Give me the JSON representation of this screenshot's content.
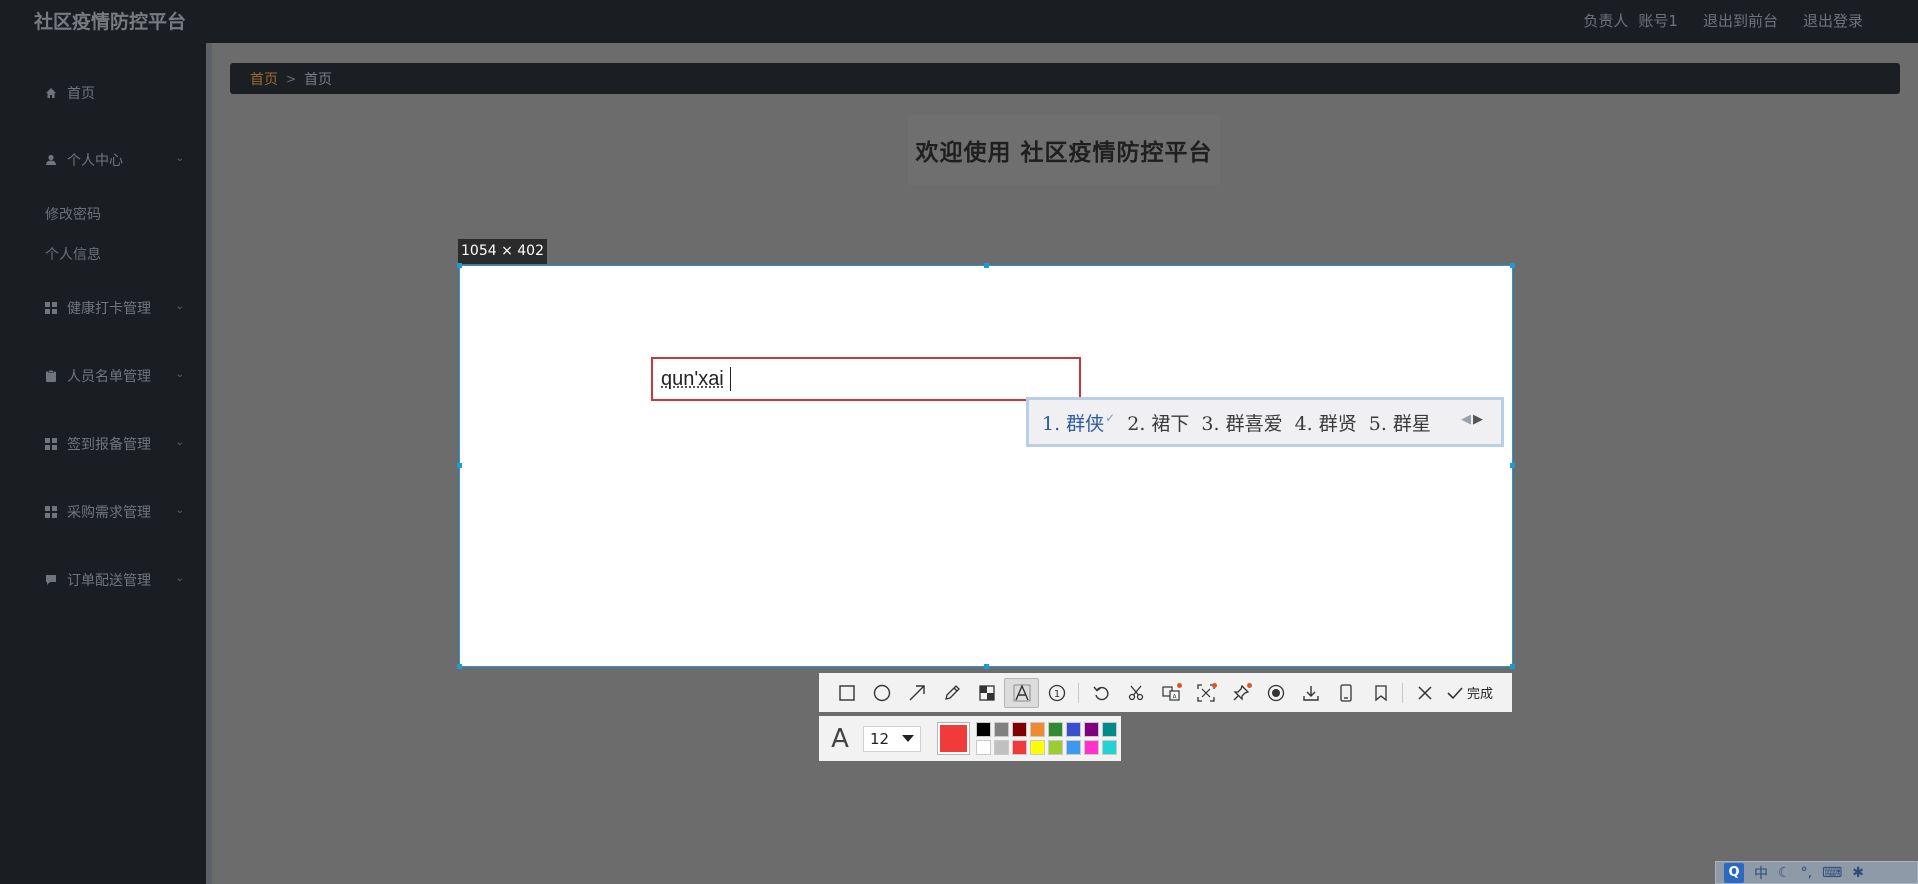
{
  "header": {
    "app_title": "社区疫情防控平台",
    "role": "负责人",
    "account": "账号1",
    "exit_front": "退出到前台",
    "logout": "退出登录"
  },
  "sidebar": {
    "home": "首页",
    "personal_center": "个人中心",
    "change_password": "修改密码",
    "personal_info": "个人信息",
    "health_checkin": "健康打卡管理",
    "personnel_list": "人员名单管理",
    "signin_report": "签到报备管理",
    "purchase_demand": "采购需求管理",
    "order_delivery": "订单配送管理"
  },
  "breadcrumb": {
    "home": "首页",
    "current": "首页"
  },
  "main": {
    "welcome": "欢迎使用 社区疫情防控平台"
  },
  "capture": {
    "size_label": "1054 × 402",
    "typed_text": "qun'xai",
    "ime_candidates": [
      "1. 群侠",
      "2. 裙下",
      "3. 群喜爱",
      "4. 群贤",
      "5. 群星"
    ]
  },
  "toolbar": {
    "icons": [
      "rectangle-icon",
      "ellipse-icon",
      "arrow-icon",
      "pencil-icon",
      "mosaic-icon",
      "text-icon",
      "number-icon",
      "undo-icon",
      "cut-icon",
      "translate-icon",
      "ocr-icon",
      "pin-icon",
      "record-icon",
      "download-icon",
      "phone-icon",
      "bookmark-icon",
      "close-icon"
    ],
    "done": "完成"
  },
  "text_options": {
    "font_size": "12",
    "current_color": "#f13a3a",
    "palette_top": [
      "#000000",
      "#808080",
      "#800000",
      "#f08a30",
      "#2e8b2e",
      "#3a4fd0",
      "#800080",
      "#008b8b"
    ],
    "palette_bottom": [
      "#ffffff",
      "#c0c0c0",
      "#f13a3a",
      "#ffff00",
      "#9acd32",
      "#3a9af0",
      "#ff33cc",
      "#22d3d3"
    ]
  },
  "tray": {
    "ime_mode": "中"
  }
}
